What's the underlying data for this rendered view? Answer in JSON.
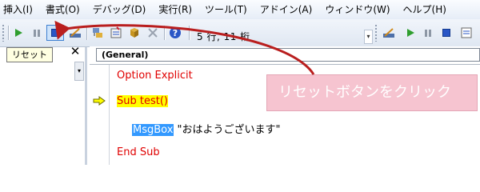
{
  "menubar": {
    "items": [
      "挿入(I)",
      "書式(O)",
      "デバッグ(D)",
      "実行(R)",
      "ツール(T)",
      "アドイン(A)",
      "ウィンドウ(W)",
      "ヘルプ(H)"
    ]
  },
  "toolbar": {
    "position_text": "5 行, 11 桁",
    "buttons": [
      "run-icon",
      "break-icon",
      "reset-icon",
      "design-mode-icon",
      "project-explorer-icon",
      "properties-icon",
      "object-browser-icon",
      "toolbox-icon",
      "help-icon"
    ],
    "colors": {
      "run": "#2f9e2f",
      "reset": "#2a56c6",
      "pressed": "#cde3fb"
    }
  },
  "left_pane": {
    "tooltip": "リセット",
    "close_glyph": "✕"
  },
  "code_window": {
    "object_combo": "(General)",
    "lines": {
      "option": "Option Explicit",
      "sub": "Sub test()",
      "call_ident": "MsgBox",
      "call_arg": " \"おはようございます\"",
      "end": "End Sub"
    },
    "colors": {
      "keyword": "#e00000",
      "execution_highlight": "#ffff00",
      "selection": "#3399ff"
    }
  },
  "annotation": {
    "callout_text": "リセットボタンをクリック",
    "colors": {
      "callout_fill": "#f6c4d0",
      "arrow": "#b91e1e"
    }
  }
}
